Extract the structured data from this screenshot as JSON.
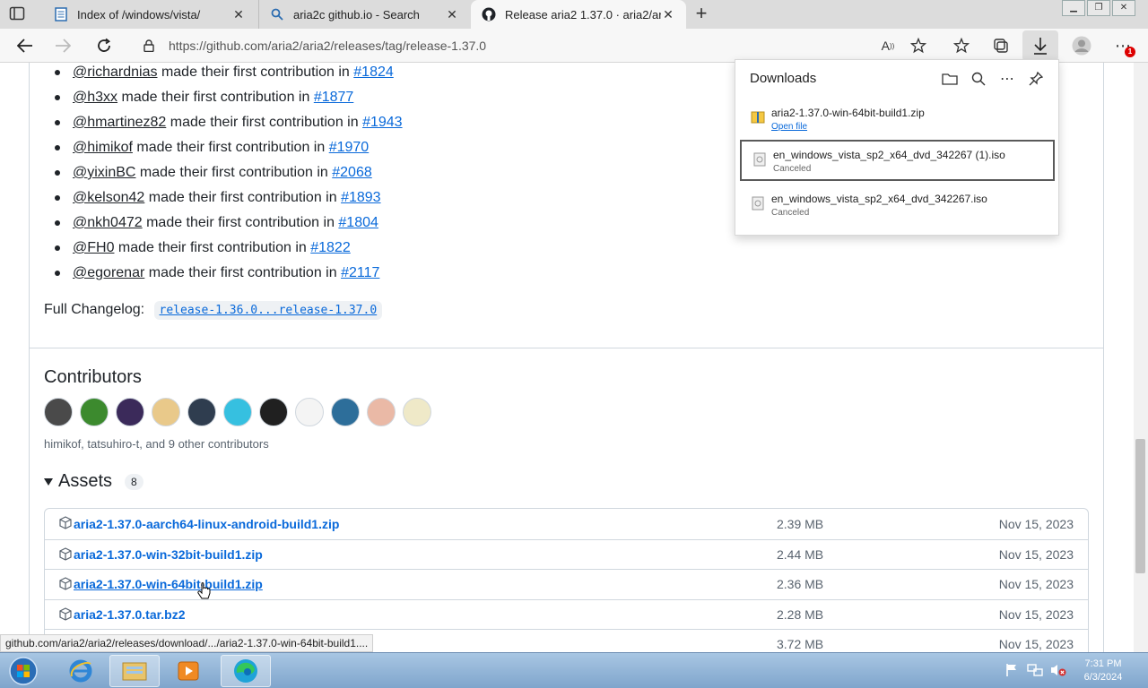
{
  "browser": {
    "tabs": [
      {
        "title": "Index of /windows/vista/",
        "icon": "document-icon"
      },
      {
        "title": "aria2c github.io - Search",
        "icon": "search-icon"
      },
      {
        "title": "Release aria2 1.37.0 · aria2/aria2",
        "icon": "github-icon"
      }
    ],
    "url": "https://github.com/aria2/aria2/releases/tag/release-1.37.0",
    "notification_count": "1"
  },
  "contributions": [
    {
      "user": "@richardnias",
      "text": " made their first contribution in ",
      "pr": "#1824"
    },
    {
      "user": "@h3xx",
      "text": " made their first contribution in ",
      "pr": "#1877"
    },
    {
      "user": "@hmartinez82",
      "text": " made their first contribution in ",
      "pr": "#1943"
    },
    {
      "user": "@himikof",
      "text": " made their first contribution in ",
      "pr": "#1970"
    },
    {
      "user": "@yixinBC",
      "text": " made their first contribution in ",
      "pr": "#2068"
    },
    {
      "user": "@kelson42",
      "text": " made their first contribution in ",
      "pr": "#1893"
    },
    {
      "user": "@nkh0472",
      "text": " made their first contribution in ",
      "pr": "#1804"
    },
    {
      "user": "@FH0",
      "text": " made their first contribution in ",
      "pr": "#1822"
    },
    {
      "user": "@egorenar",
      "text": " made their first contribution in ",
      "pr": "#2117"
    }
  ],
  "changelog": {
    "label": "Full Changelog:",
    "link": "release-1.36.0...release-1.37.0"
  },
  "contributors": {
    "heading": "Contributors",
    "names": "himikof, tatsuhiro-t, and 9 other contributors",
    "avatar_colors": [
      "#4a4a4a",
      "#3c8a2e",
      "#3b2a5a",
      "#e9c98a",
      "#2f3d4f",
      "#36c0e0",
      "#202020",
      "#f4f4f4",
      "#2d6e9a",
      "#eab9a6",
      "#efe9c8"
    ]
  },
  "assets": {
    "heading": "Assets",
    "count": "8",
    "rows": [
      {
        "name": "aria2-1.37.0-aarch64-linux-android-build1.zip",
        "size": "2.39 MB",
        "date": "Nov 15, 2023"
      },
      {
        "name": "aria2-1.37.0-win-32bit-build1.zip",
        "size": "2.44 MB",
        "date": "Nov 15, 2023"
      },
      {
        "name": "aria2-1.37.0-win-64bit-build1.zip",
        "size": "2.36 MB",
        "date": "Nov 15, 2023"
      },
      {
        "name": "aria2-1.37.0.tar.bz2",
        "size": "2.28 MB",
        "date": "Nov 15, 2023"
      },
      {
        "name": "",
        "size": "3.72 MB",
        "date": "Nov 15, 2023"
      }
    ]
  },
  "status_link": "github.com/aria2/aria2/releases/download/.../aria2-1.37.0-win-64bit-build1....",
  "downloads": {
    "title": "Downloads",
    "items": [
      {
        "file": "aria2-1.37.0-win-64bit-build1.zip",
        "status": "Open file"
      },
      {
        "file": "en_windows_vista_sp2_x64_dvd_342267 (1).iso",
        "status": "Canceled"
      },
      {
        "file": "en_windows_vista_sp2_x64_dvd_342267.iso",
        "status": "Canceled"
      }
    ]
  },
  "taskbar": {
    "time": "7:31 PM",
    "date": "6/3/2024"
  }
}
